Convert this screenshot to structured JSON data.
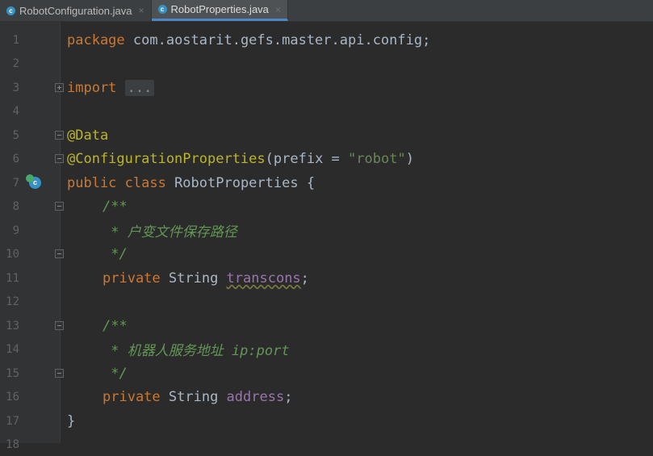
{
  "tabs": [
    {
      "label": "RobotConfiguration.java",
      "icon": "class-icon",
      "active": false
    },
    {
      "label": "RobotProperties.java",
      "icon": "class-icon",
      "active": true
    }
  ],
  "tab_close_glyph": "×",
  "class_icon_glyph": "c",
  "editor": {
    "line_numbers": [
      "1",
      "2",
      "3",
      "4",
      "5",
      "6",
      "7",
      "8",
      "9",
      "10",
      "11",
      "12",
      "13",
      "14",
      "15",
      "16",
      "17",
      "18"
    ],
    "lines": {
      "l1": {
        "kw": "package",
        "text": " com.aostarit.gefs.master.api.config;"
      },
      "l3": {
        "kw": "import",
        "ellipsis": "..."
      },
      "l6": {
        "ann": "@Data"
      },
      "l7": {
        "ann": "@ConfigurationProperties",
        "open": "(",
        "param": "prefix",
        "eq": " = ",
        "str": "\"robot\"",
        "close": ")"
      },
      "l8": {
        "kw": "public class",
        "text": " RobotProperties {"
      },
      "l9": {
        "cmt": "/**"
      },
      "l10": {
        "cmt": " * 户变文件保存路径"
      },
      "l11": {
        "cmt": " */"
      },
      "l12": {
        "kw": "private",
        "type": " String ",
        "field": "transcons",
        "end": ";"
      },
      "l14": {
        "cmt": "/**"
      },
      "l15": {
        "cmt": " * 机器人服务地址 ip:port"
      },
      "l16": {
        "cmt": " */"
      },
      "l17": {
        "kw": "private",
        "type": " String ",
        "field": "address",
        "end": ";"
      },
      "l18": {
        "text": "}"
      }
    }
  },
  "colors": {
    "background": "#2b2b2b",
    "keyword": "#cc7832",
    "annotation": "#bbb529",
    "string": "#6a8759",
    "comment": "#629755",
    "field": "#9876aa"
  }
}
